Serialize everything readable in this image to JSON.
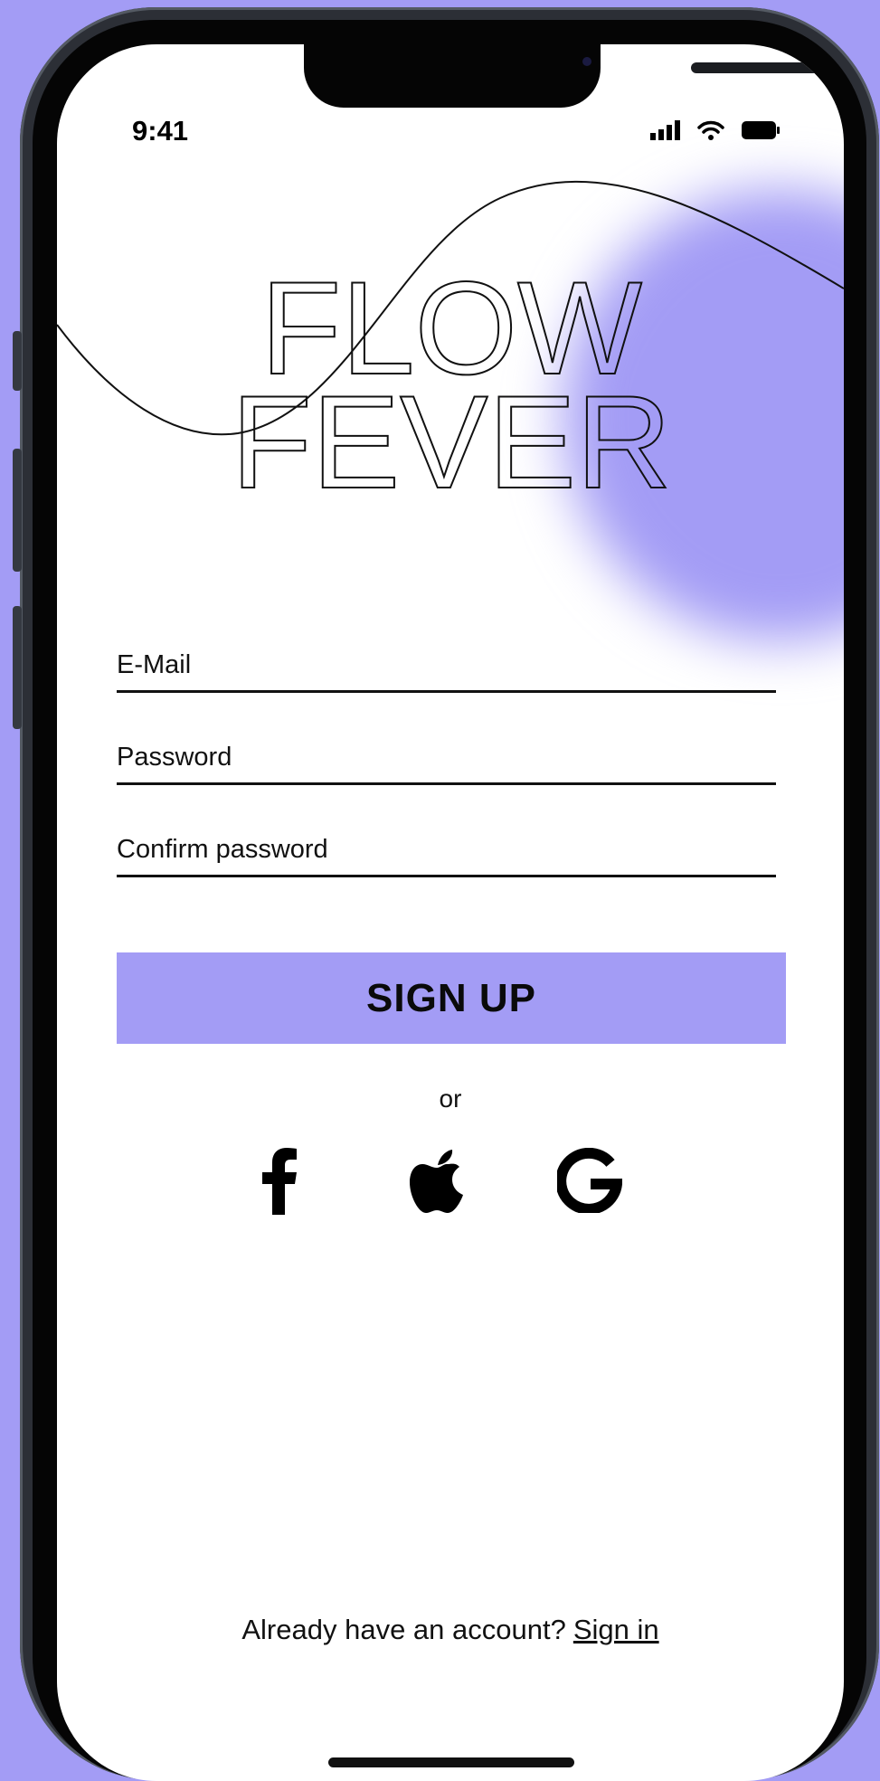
{
  "status": {
    "time": "9:41"
  },
  "brand": {
    "line1": "FLOW",
    "line2": "FEVER"
  },
  "form": {
    "email_placeholder": "E-Mail",
    "password_placeholder": "Password",
    "confirm_placeholder": "Confirm password",
    "signup_label": "SIGN UP"
  },
  "divider_text": "or",
  "social": [
    "facebook-icon",
    "apple-icon",
    "google-icon"
  ],
  "footer": {
    "prompt": "Already have an account?",
    "link": "Sign in"
  },
  "colors": {
    "accent": "#a39cf5",
    "text": "#111111",
    "frame": "#2c2f36"
  }
}
